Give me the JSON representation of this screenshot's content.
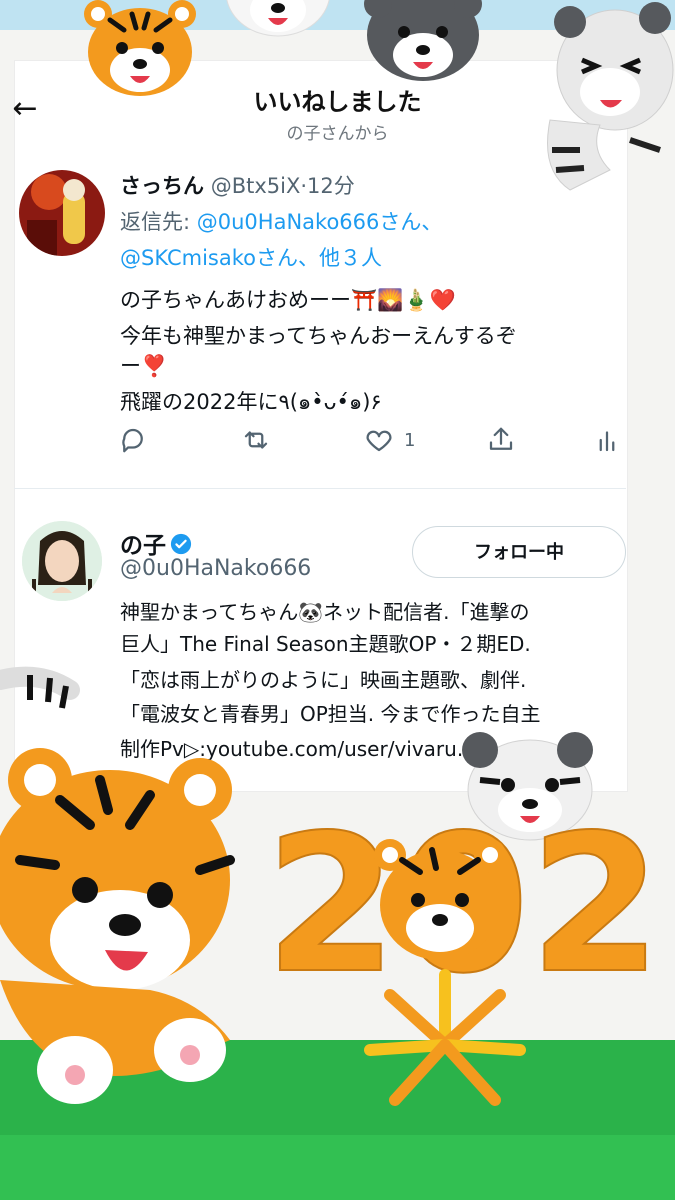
{
  "header": {
    "back_label": "←",
    "title": "いいねしました",
    "subtitle": "の子さんから"
  },
  "tweet": {
    "display_name": "さっちん",
    "handle": "@Btx5iX",
    "separator": "·",
    "time": "12分",
    "reply_prefix": "返信先: ",
    "reply_to_1": "@0u0HaNako666",
    "reply_suffix_1": "さん、",
    "reply_to_2": "@SKCmisako",
    "reply_suffix_2": "さん、",
    "reply_more": "他３人",
    "text_lines": [
      "の子ちゃんあけおめーー⛩️🌄🎍❤️",
      "今年も神聖かまってちゃんおーえんするぞ",
      "ー❣️",
      "飛躍の2022年に٩(๑•̀ᴗ•́๑)۶"
    ],
    "like_count": "1"
  },
  "profile": {
    "display_name": "の子",
    "handle": "@0u0HaNako666",
    "follow_label": "フォロー中",
    "bio_lines": [
      "神聖かまってちゃん🐼ネット配信者.「進撃の",
      "巨人」The Final Season主題歌OP・２期ED.",
      "「恋は雨上がりのように」映画主題歌、劇伴.",
      "「電波女と青春男」OP担当. 今まで作った自主",
      "制作Pv▷:youtube.com/user/vivaru..."
    ]
  },
  "decoration": {
    "year_text": "2022"
  },
  "colors": {
    "link": "#1d9bf0",
    "muted": "#536471",
    "tiger_orange": "#f39a1e",
    "grass": "#2bb24a"
  }
}
